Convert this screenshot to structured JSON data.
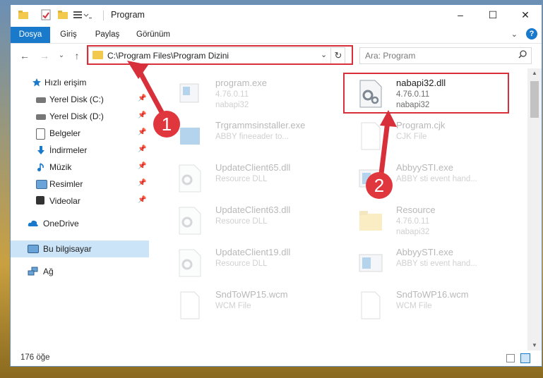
{
  "window": {
    "title": "Program",
    "controls": {
      "minimize": "–",
      "maximize": "☐",
      "close": "✕"
    }
  },
  "ribbon": {
    "tabs": [
      "Dosya",
      "Giriş",
      "Paylaş",
      "Görünüm"
    ],
    "expand": "⌄",
    "help": "?"
  },
  "nav": {
    "back": "←",
    "forward": "→",
    "recent": "⌄",
    "up": "↑",
    "address": "C:\\Program Files\\Program Dizini",
    "address_chevron": "⌄",
    "refresh": "↻",
    "search_placeholder": "Ara: Program"
  },
  "sidebar": {
    "quick_access": "Hızlı erişim",
    "items": [
      {
        "label": "Yerel Disk (C:)",
        "icon": "drive-icon",
        "pinned": true
      },
      {
        "label": "Yerel Disk (D:)",
        "icon": "drive-icon",
        "pinned": true
      },
      {
        "label": "Belgeler",
        "icon": "documents-icon",
        "pinned": true
      },
      {
        "label": "İndirmeler",
        "icon": "download-icon",
        "pinned": true
      },
      {
        "label": "Müzik",
        "icon": "music-icon",
        "pinned": true
      },
      {
        "label": "Resimler",
        "icon": "pictures-icon",
        "pinned": true
      },
      {
        "label": "Videolar",
        "icon": "videos-icon",
        "pinned": true
      }
    ],
    "onedrive": "OneDrive",
    "this_pc": "Bu bilgisayar",
    "network": "Ağ"
  },
  "files": [
    {
      "name": "program.exe",
      "line1": "4.76.0.11",
      "line2": "nabapi32",
      "icon": "exe-icon",
      "faded": true
    },
    {
      "name": "nabapi32.dll",
      "line1": "4.76.0.11",
      "line2": "nabapi32",
      "icon": "dll-gear-icon",
      "faded": false
    },
    {
      "name": "Trgrammsinstaller.exe",
      "line1": "ABBY fineeader to...",
      "line2": "",
      "icon": "installer-icon",
      "faded": true
    },
    {
      "name": "Program.cjk",
      "line1": "CJK File",
      "line2": "",
      "icon": "file-icon",
      "faded": true
    },
    {
      "name": "UpdateClient65.dll",
      "line1": "Resource DLL",
      "line2": "",
      "icon": "dll-gear-icon",
      "faded": true
    },
    {
      "name": "AbbyySTI.exe",
      "line1": "ABBY sti event hand...",
      "line2": "",
      "icon": "window-icon",
      "faded": true
    },
    {
      "name": "UpdateClient63.dll",
      "line1": "Resource DLL",
      "line2": "",
      "icon": "dll-gear-icon",
      "faded": true
    },
    {
      "name": "Resource",
      "line1": "4.76.0.11",
      "line2": "nabapi32",
      "icon": "folder-icon",
      "faded": true
    },
    {
      "name": "UpdateClient19.dll",
      "line1": "Resource DLL",
      "line2": "",
      "icon": "dll-gear-icon",
      "faded": true
    },
    {
      "name": "AbbyySTI.exe",
      "line1": "ABBY sti event hand...",
      "line2": "",
      "icon": "window-icon",
      "faded": true
    },
    {
      "name": "SndToWP15.wcm",
      "line1": "WCM File",
      "line2": "",
      "icon": "file-icon",
      "faded": true
    },
    {
      "name": "SndToWP16.wcm",
      "line1": "WCM File",
      "line2": "",
      "icon": "file-icon",
      "faded": true
    }
  ],
  "status": {
    "count": "176 öğe"
  },
  "annotations": {
    "step1": "1",
    "step2": "2",
    "color": "#d8303a"
  },
  "colors": {
    "accent": "#1979ca",
    "selection": "#cce4f7",
    "highlight": "#d8303a"
  }
}
